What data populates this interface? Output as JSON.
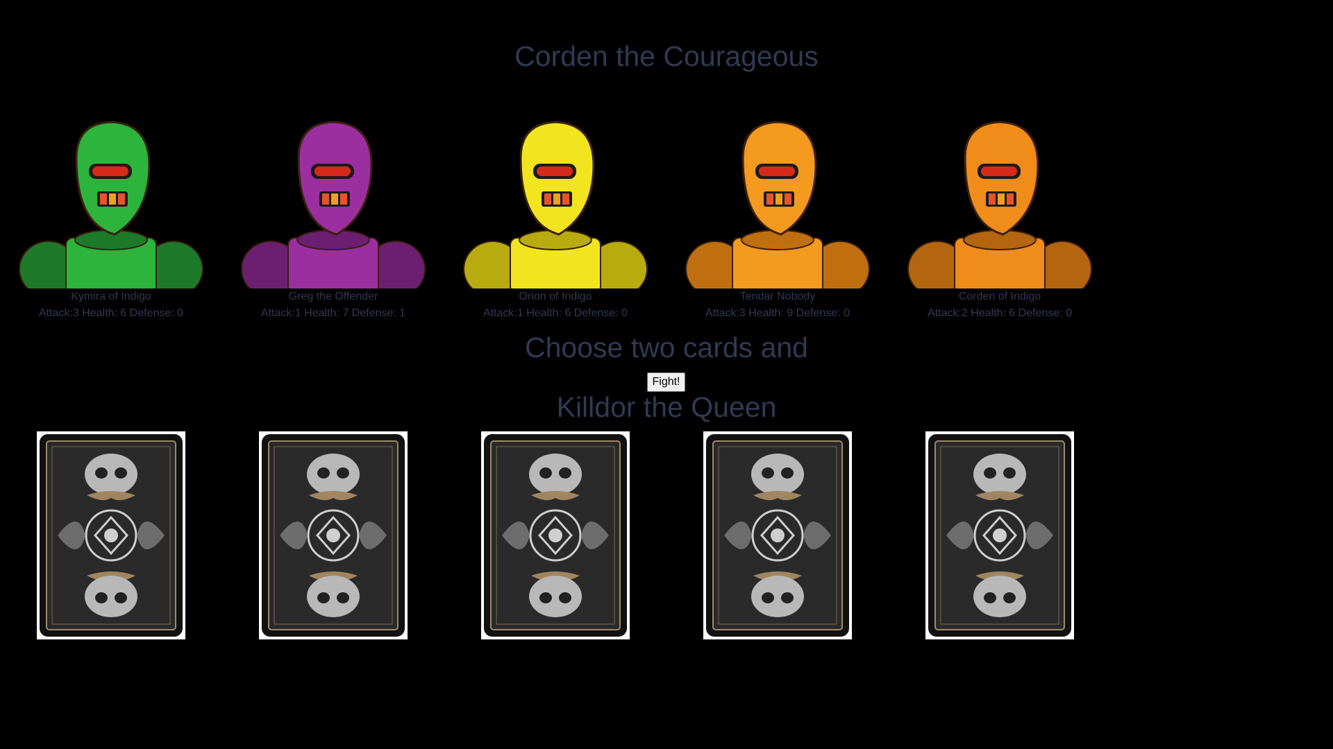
{
  "player": {
    "title": "Corden the Courageous",
    "robots": [
      {
        "name": "Kymira of Indigo",
        "stats": "Attack:3 Health: 6 Defense: 0",
        "color": "#2db43c",
        "shade": "#1c7a28",
        "icon": "green-robot-icon"
      },
      {
        "name": "Greg the Offender",
        "stats": "Attack:1 Health: 7 Defense: 1",
        "color": "#9b2fa0",
        "shade": "#6c1f70",
        "icon": "purple-robot-icon"
      },
      {
        "name": "Orion of Indigo",
        "stats": "Attack:1 Health: 6 Defense: 0",
        "color": "#f2e41f",
        "shade": "#b8ab10",
        "icon": "yellow-robot-icon"
      },
      {
        "name": "Tendar Nobody",
        "stats": "Attack:3 Health: 9 Defense: 0",
        "color": "#f39a1f",
        "shade": "#c06f10",
        "icon": "orange-robot-icon"
      },
      {
        "name": "Corden of Indigo",
        "stats": "Attack:2 Health: 6 Defense: 0",
        "color": "#f08c1a",
        "shade": "#b4650f",
        "icon": "orange-knight-robot-icon"
      }
    ]
  },
  "prompt": "Choose two cards and",
  "fight_label": "Fight!",
  "enemy": {
    "title": "Killdor the Queen",
    "cards": [
      {
        "icon": "card-back-icon"
      },
      {
        "icon": "card-back-icon"
      },
      {
        "icon": "card-back-icon"
      },
      {
        "icon": "card-back-icon"
      },
      {
        "icon": "card-back-icon"
      }
    ]
  }
}
